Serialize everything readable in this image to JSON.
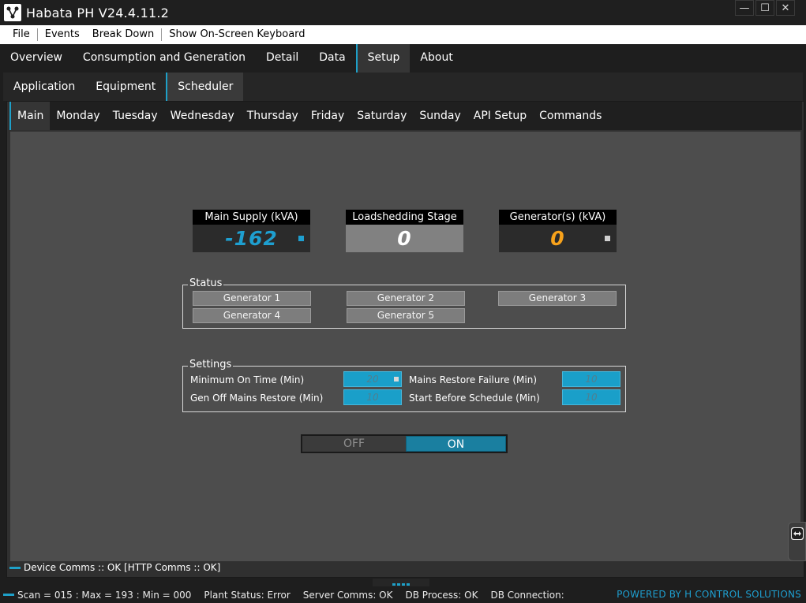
{
  "window": {
    "title": "Habata PH V24.4.11.2",
    "controls": {
      "minimize": "—",
      "maximize": "☐",
      "close": "✕"
    }
  },
  "menubar": [
    "File",
    "Events",
    "Break Down",
    "Show On-Screen Keyboard"
  ],
  "main_tabs": [
    {
      "label": "Overview"
    },
    {
      "label": "Consumption and Generation"
    },
    {
      "label": "Detail"
    },
    {
      "label": "Data"
    },
    {
      "label": "Setup",
      "active": true
    },
    {
      "label": "About"
    }
  ],
  "setup_tabs": [
    {
      "label": "Application"
    },
    {
      "label": "Equipment"
    },
    {
      "label": "Scheduler",
      "active": true
    }
  ],
  "scheduler_tabs": [
    {
      "label": "Main",
      "active": true
    },
    {
      "label": "Monday"
    },
    {
      "label": "Tuesday"
    },
    {
      "label": "Wednesday"
    },
    {
      "label": "Thursday"
    },
    {
      "label": "Friday"
    },
    {
      "label": "Saturday"
    },
    {
      "label": "Sunday"
    },
    {
      "label": "API Setup"
    },
    {
      "label": "Commands"
    }
  ],
  "gauges": {
    "main_supply": {
      "label": "Main Supply (kVA)",
      "value": "-162",
      "color": "#1e9fd0"
    },
    "loadshedding": {
      "label": "Loadshedding Stage",
      "value": "0",
      "color": "#ffffff"
    },
    "generators": {
      "label": "Generator(s) (kVA)",
      "value": "0",
      "color": "#f7a21b"
    }
  },
  "status": {
    "title": "Status",
    "generators": [
      "Generator 1",
      "Generator 2",
      "Generator 3",
      "Generator 4",
      "Generator 5"
    ]
  },
  "settings": {
    "title": "Settings",
    "min_on_time": {
      "label": "Minimum On Time (Min)",
      "value": "20"
    },
    "mains_restore_failure": {
      "label": "Mains Restore Failure (Min)",
      "value": "10"
    },
    "gen_off_mains_restore": {
      "label": "Gen Off Mains Restore (Min)",
      "value": "10"
    },
    "start_before_schedule": {
      "label": "Start Before Schedule (Min)",
      "value": "10"
    }
  },
  "toggle": {
    "off_label": "OFF",
    "on_label": "ON",
    "state": "on"
  },
  "device_comms": "Device Comms :: OK [HTTP Comms :: OK]",
  "statusbar": {
    "scan": "Scan = 015 : Max = 193 : Min = 000",
    "plant_status": "Plant Status: Error",
    "server_comms": "Server Comms: OK",
    "db_process": "DB Process:  OK",
    "db_connection": "DB Connection:",
    "powered_by": "POWERED BY H CONTROL SOLUTIONS"
  },
  "colors": {
    "accent": "#1ea0c8",
    "panel": "#4d4d4d",
    "input": "#1a9fc9"
  }
}
